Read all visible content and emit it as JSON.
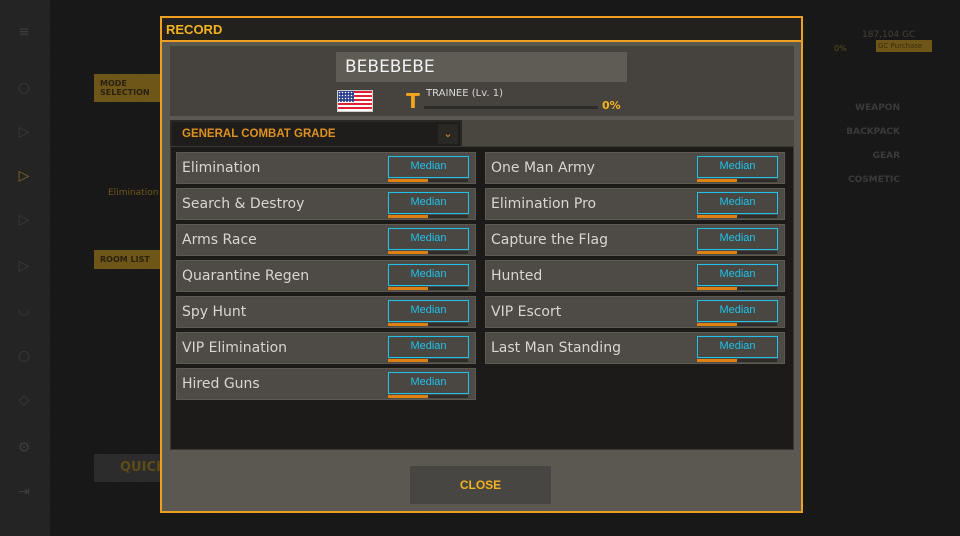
{
  "background": {
    "mode_selection": "MODE SELECTION",
    "room_list": "ROOM LIST",
    "quick": "QUICK",
    "mode_name": "Elimination",
    "loadout": [
      "WEAPON",
      "BACKPACK",
      "GEAR",
      "COSMETIC"
    ],
    "gc_purchase": "GC Purchase",
    "gc_amount": "187,104 GC",
    "xp_pct": "0%"
  },
  "modal": {
    "title": "RECORD",
    "player_name": "BEBEBEBE",
    "country_flag": "us-flag",
    "rank_icon": "trainee-rank-icon",
    "rank_label": "TRAINEE (Lv. 1)",
    "xp_progress_percent": 0,
    "xp_label": "0%",
    "grade_dropdown": "GENERAL COMBAT GRADE",
    "modes_left": [
      {
        "name": "Elimination",
        "grade": "Median",
        "fill": 0.5
      },
      {
        "name": "Search & Destroy",
        "grade": "Median",
        "fill": 0.5
      },
      {
        "name": "Arms Race",
        "grade": "Median",
        "fill": 0.5
      },
      {
        "name": "Quarantine Regen",
        "grade": "Median",
        "fill": 0.5
      },
      {
        "name": "Spy Hunt",
        "grade": "Median",
        "fill": 0.5
      },
      {
        "name": "VIP Elimination",
        "grade": "Median",
        "fill": 0.5
      },
      {
        "name": "Hired Guns",
        "grade": "Median",
        "fill": 0.5
      }
    ],
    "modes_right": [
      {
        "name": "One Man Army",
        "grade": "Median",
        "fill": 0.5
      },
      {
        "name": "Elimination Pro",
        "grade": "Median",
        "fill": 0.5
      },
      {
        "name": "Capture the Flag",
        "grade": "Median",
        "fill": 0.5
      },
      {
        "name": "Hunted",
        "grade": "Median",
        "fill": 0.5
      },
      {
        "name": "VIP Escort",
        "grade": "Median",
        "fill": 0.5
      },
      {
        "name": "Last Man Standing",
        "grade": "Median",
        "fill": 0.5
      }
    ],
    "close_label": "CLOSE"
  },
  "colors": {
    "accent": "#f0a020",
    "grade": "#1ec2ea",
    "grade_bar": "#e08010"
  }
}
